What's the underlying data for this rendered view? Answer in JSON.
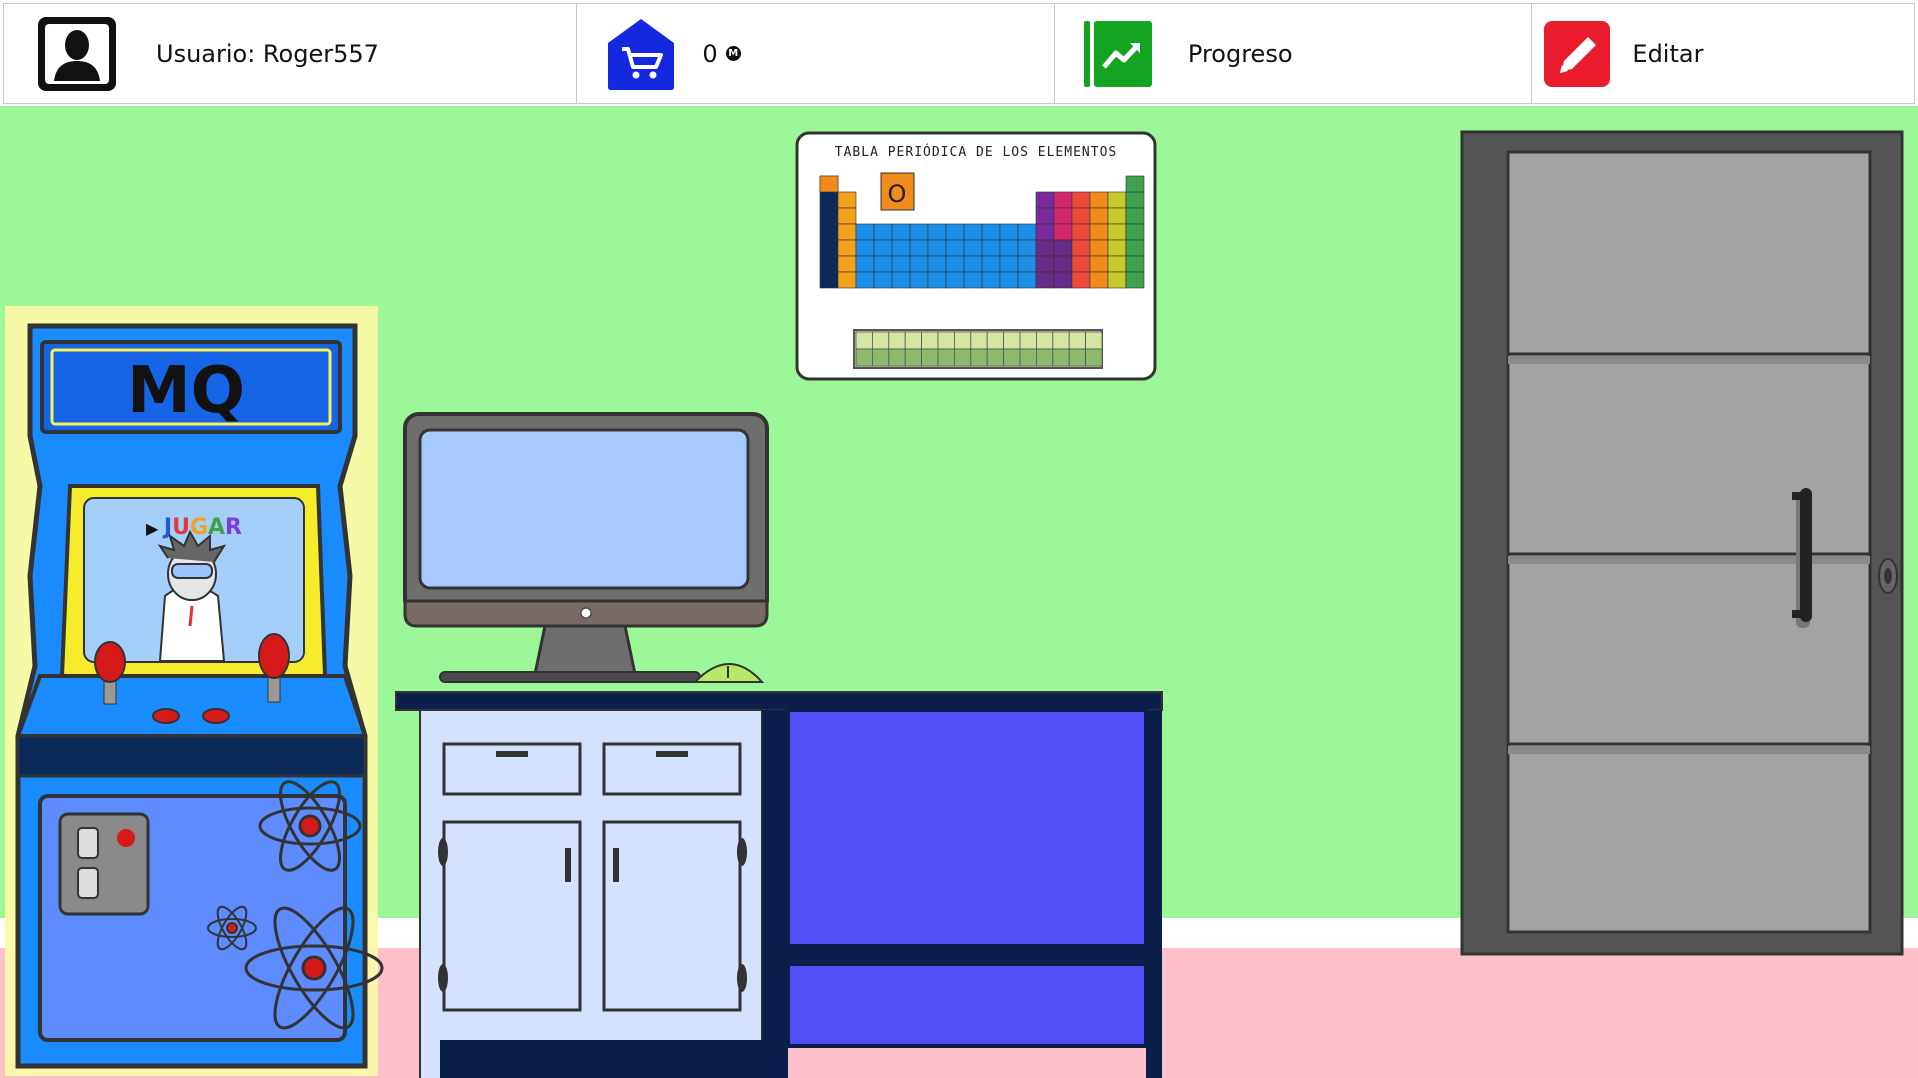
{
  "header": {
    "user_label": "Usuario: Roger557",
    "coins_value": "0",
    "coin_symbol": "M",
    "progress_label": "Progreso",
    "edit_label": "Editar"
  },
  "scene": {
    "arcade": {
      "marquee": "MQ",
      "play_prefix": "▶",
      "play_letters": [
        "J",
        "U",
        "G",
        "A",
        "R"
      ],
      "play_colors": [
        "#1e5bd8",
        "#e23a3a",
        "#f0a21e",
        "#3fa34d",
        "#7a3fd8"
      ]
    },
    "poster": {
      "title": "TABLA PERIÓDICA DE LOS ELEMENTOS",
      "highlight_symbol": "O"
    }
  },
  "colors": {
    "wall": "#9bf797",
    "floor": "#ffc0cb",
    "baseboard": "#ffffff",
    "shop_icon": "#1428e0",
    "progress_icon": "#13a421",
    "edit_icon": "#e81c2c",
    "desk_panel": "#4f4ff5",
    "door": "#a3a3a3"
  },
  "icons": {
    "user": "user-silhouette-icon",
    "shop": "shopping-cart-icon",
    "progress": "trending-up-icon",
    "edit": "pencil-icon"
  }
}
